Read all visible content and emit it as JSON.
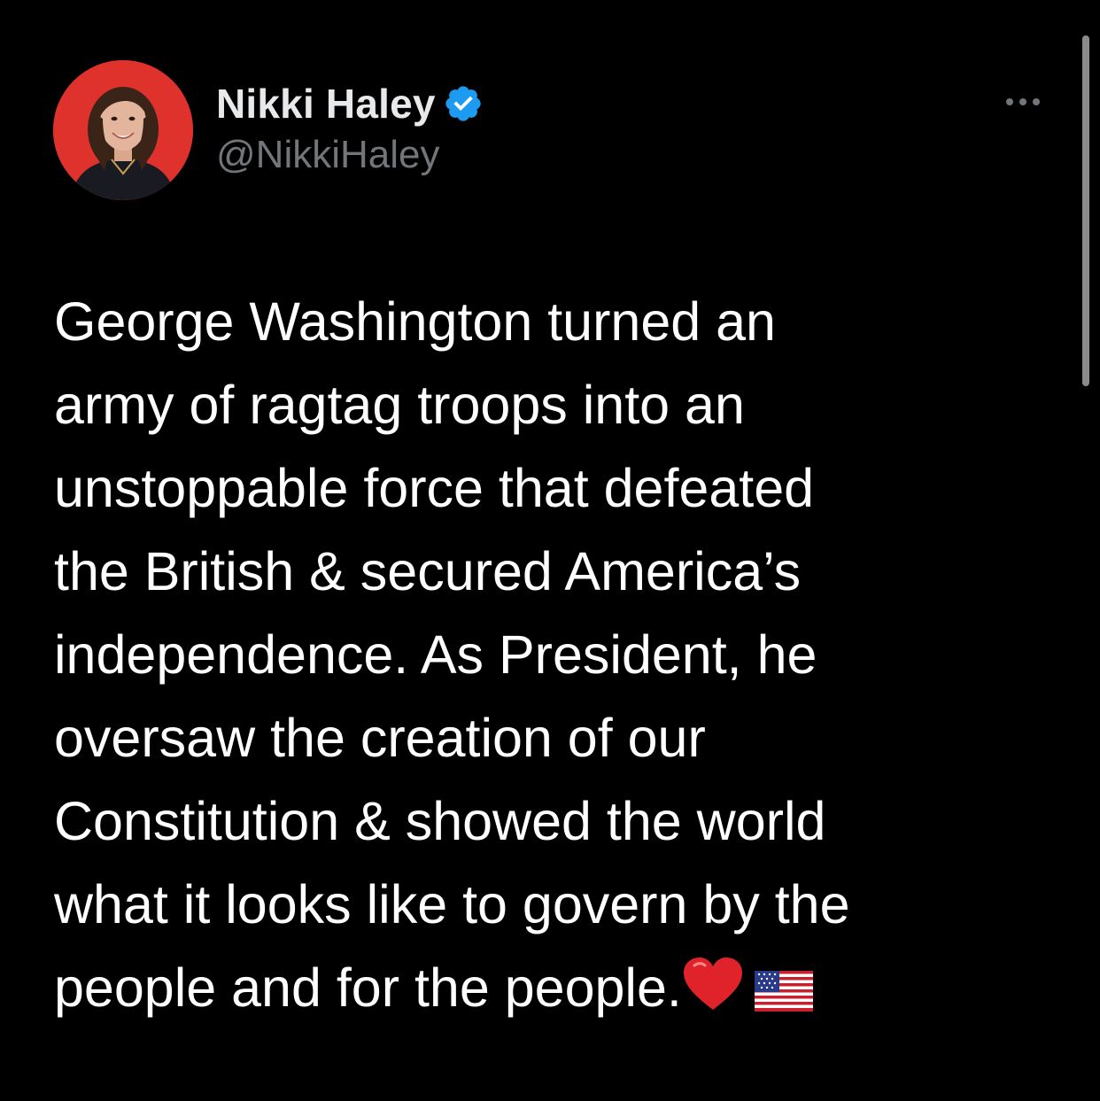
{
  "author": {
    "display_name": "Nikki Haley",
    "handle": "@NikkiHaley",
    "verified": true,
    "avatar_icon": "profile-photo-red-background"
  },
  "tweet": {
    "lines": [
      "George Washington turned an",
      "army of ragtag troops into an",
      "unstoppable force that defeated",
      "the British & secured America’s",
      "independence. As President, he",
      "oversaw the creation of our",
      "Constitution & showed the world",
      "what it looks like to govern by the",
      "people and for the people."
    ],
    "emojis": [
      "red-heart-emoji",
      "us-flag-emoji"
    ]
  },
  "more_menu": {
    "icon": "more-horizontal-icon"
  },
  "colors": {
    "background": "#000000",
    "text_primary": "#ffffff",
    "text_secondary": "#71767b",
    "verified_blue": "#1d9bf0",
    "avatar_bg": "#e0322c"
  }
}
